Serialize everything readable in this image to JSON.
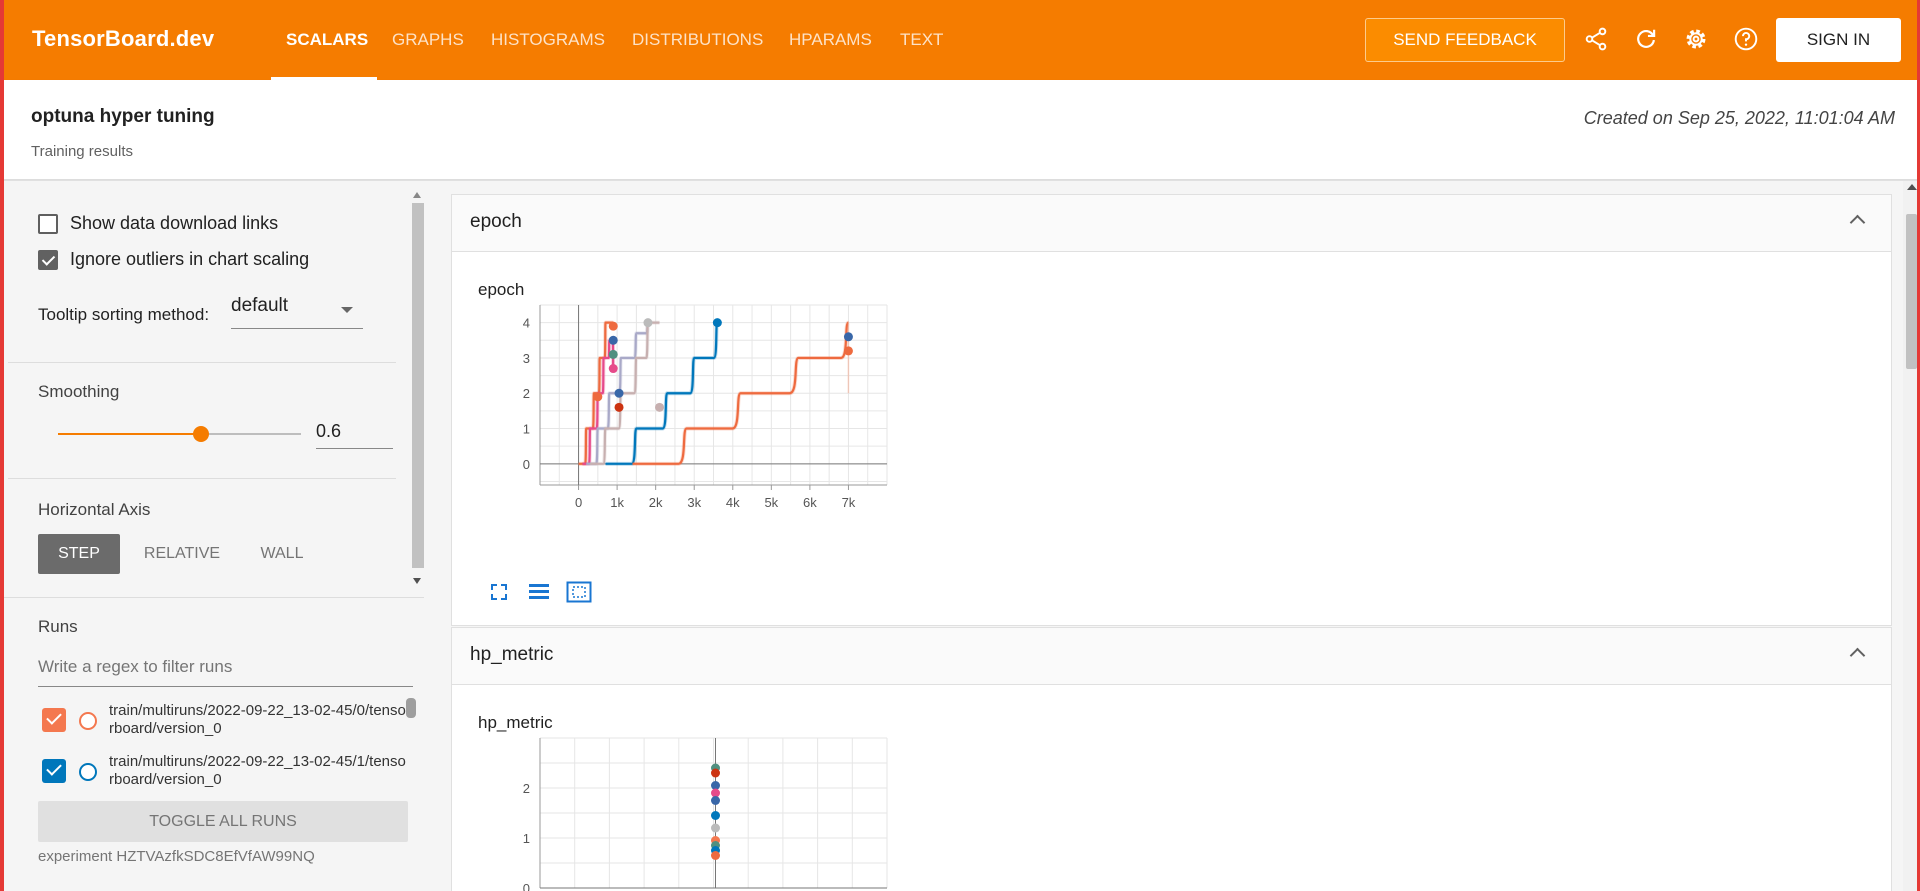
{
  "topbar": {
    "brand": "TensorBoard.dev",
    "tabs": [
      {
        "label": "SCALARS",
        "active": true
      },
      {
        "label": "GRAPHS"
      },
      {
        "label": "HISTOGRAMS"
      },
      {
        "label": "DISTRIBUTIONS"
      },
      {
        "label": "HPARAMS"
      },
      {
        "label": "TEXT"
      }
    ],
    "feedback_label": "SEND FEEDBACK",
    "signin_label": "SIGN IN",
    "icons": [
      "share-icon",
      "refresh-icon",
      "settings-icon",
      "help-icon"
    ],
    "accent": "#f57c00"
  },
  "header": {
    "title": "optuna hyper tuning",
    "subtitle": "Training results",
    "created": "Created on Sep 25, 2022, 11:01:04 AM"
  },
  "sidebar": {
    "show_download_links": {
      "label": "Show data download links",
      "checked": false
    },
    "ignore_outliers": {
      "label": "Ignore outliers in chart scaling",
      "checked": true
    },
    "tooltip_sorting": {
      "label": "Tooltip sorting method:",
      "value": "default"
    },
    "smoothing": {
      "label": "Smoothing",
      "value": "0.6",
      "fraction": 0.6
    },
    "horizontal_axis": {
      "label": "Horizontal Axis",
      "options": [
        "STEP",
        "RELATIVE",
        "WALL"
      ],
      "selected": "STEP"
    },
    "runs": {
      "label": "Runs",
      "filter_placeholder": "Write a regex to filter runs",
      "items": [
        {
          "name": "train/multiruns/2022-09-22_13-02-45/0/tensorboard/version_0",
          "color": "#f4784f",
          "checked": true
        },
        {
          "name": "train/multiruns/2022-09-22_13-02-45/1/tensorboard/version_0",
          "color": "#0077bb",
          "checked": true
        }
      ],
      "toggle_label": "TOGGLE ALL RUNS"
    },
    "experiment_id": "experiment HZTVAzfkSDC8EfVfAW99NQ"
  },
  "main": {
    "cards": [
      {
        "title": "epoch",
        "chart_title": "epoch"
      },
      {
        "title": "hp_metric",
        "chart_title": "hp_metric"
      }
    ]
  },
  "chart_data": [
    {
      "type": "line",
      "title": "epoch",
      "xlabel": "",
      "ylabel": "",
      "xlim": [
        -1000,
        8000
      ],
      "ylim": [
        -0.6,
        4.5
      ],
      "xticks": [
        "0",
        "1k",
        "2k",
        "3k",
        "4k",
        "5k",
        "6k",
        "7k"
      ],
      "yticks": [
        "0",
        "1",
        "2",
        "3",
        "4"
      ],
      "grid": true,
      "series": [
        {
          "color": "#ee6a3f",
          "x": [
            0,
            200,
            400,
            550,
            700,
            800,
            900
          ],
          "y": [
            0,
            1,
            2,
            3,
            4,
            4,
            4
          ]
        },
        {
          "color": "#e64a8a",
          "x": [
            100,
            300,
            500,
            650,
            800,
            900
          ],
          "y": [
            0,
            1,
            2,
            3,
            3.5,
            2.7
          ]
        },
        {
          "color": "#a9a9c8",
          "x": [
            200,
            500,
            800,
            1100,
            1500,
            1800
          ],
          "y": [
            0,
            1,
            2,
            3,
            3.7,
            4
          ]
        },
        {
          "color": "#c7b0b0",
          "x": [
            300,
            700,
            1100,
            1500,
            1800,
            2100
          ],
          "y": [
            0,
            1,
            2,
            3,
            4,
            4
          ]
        },
        {
          "color": "#0077bb",
          "x": [
            700,
            1500,
            2300,
            3000,
            3600
          ],
          "y": [
            0,
            1,
            2,
            3,
            4
          ]
        },
        {
          "color": "#ee6a3f",
          "x": [
            1400,
            2800,
            4200,
            5700,
            7000
          ],
          "y": [
            0,
            1,
            2,
            3,
            4
          ]
        }
      ],
      "end_points": [
        {
          "x": 900,
          "y": 3.9,
          "color": "#ee6a3f"
        },
        {
          "x": 900,
          "y": 3.5,
          "color": "#3967a8"
        },
        {
          "x": 900,
          "y": 3.1,
          "color": "#509080"
        },
        {
          "x": 900,
          "y": 2.7,
          "color": "#e64a8a"
        },
        {
          "x": 500,
          "y": 1.9,
          "color": "#ee6a3f"
        },
        {
          "x": 1050,
          "y": 2.0,
          "color": "#3967a8"
        },
        {
          "x": 1050,
          "y": 1.6,
          "color": "#cc3311"
        },
        {
          "x": 1800,
          "y": 4.0,
          "color": "#bbbbbb"
        },
        {
          "x": 2100,
          "y": 1.6,
          "color": "#c7b0b0"
        },
        {
          "x": 3600,
          "y": 4.0,
          "color": "#0077bb"
        },
        {
          "x": 7000,
          "y": 3.6,
          "color": "#3967a8"
        },
        {
          "x": 7000,
          "y": 3.2,
          "color": "#ee6a3f"
        }
      ]
    },
    {
      "type": "scatter",
      "title": "hp_metric",
      "xlim": [
        -1,
        1
      ],
      "ylim": [
        0,
        3
      ],
      "yticks": [
        "0",
        "1",
        "2"
      ],
      "grid": true,
      "points": [
        {
          "x": 0,
          "y": 2.4,
          "color": "#509080"
        },
        {
          "x": 0,
          "y": 2.3,
          "color": "#cc3311"
        },
        {
          "x": 0,
          "y": 2.05,
          "color": "#3967a8"
        },
        {
          "x": 0,
          "y": 1.9,
          "color": "#e64a8a"
        },
        {
          "x": 0,
          "y": 1.75,
          "color": "#3967a8"
        },
        {
          "x": 0,
          "y": 1.45,
          "color": "#0077bb"
        },
        {
          "x": 0,
          "y": 1.2,
          "color": "#bbbbbb"
        },
        {
          "x": 0,
          "y": 0.95,
          "color": "#f4784f"
        },
        {
          "x": 0,
          "y": 0.85,
          "color": "#509080"
        },
        {
          "x": 0,
          "y": 0.75,
          "color": "#0077bb"
        },
        {
          "x": 0,
          "y": 0.65,
          "color": "#ee6a3f"
        }
      ]
    }
  ]
}
